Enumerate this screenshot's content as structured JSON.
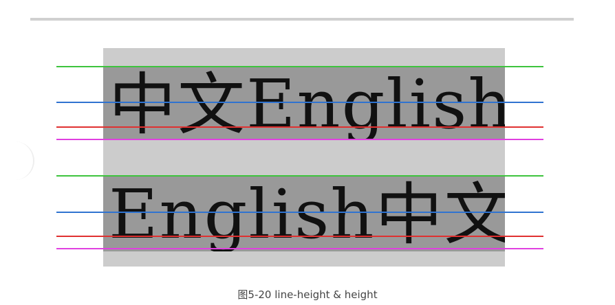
{
  "figure": {
    "line_1_text": "中文English",
    "line_2_text": "English中文",
    "colors": {
      "outer_box": "#cccccc",
      "text_band": "#999999",
      "line_top": "#3dc43d",
      "line_middle": "#2f73d0",
      "line_baseline": "#e03030",
      "line_bottom": "#e040e0"
    }
  },
  "caption": "图5-20 line-height & height"
}
